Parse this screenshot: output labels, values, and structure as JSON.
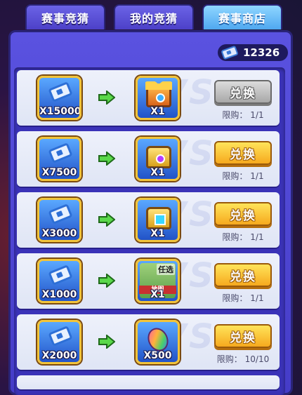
{
  "tabs": [
    {
      "label": "赛事竞猜",
      "active": false
    },
    {
      "label": "我的竞猜",
      "active": false
    },
    {
      "label": "赛事商店",
      "active": true
    }
  ],
  "balance": {
    "icon": "ticket-icon",
    "value": "12326"
  },
  "watermark": "VS",
  "items": [
    {
      "cost": "X15000",
      "reward_icon": "red-crown-chest-icon",
      "reward_qty": "X1",
      "button_label": "兑换",
      "button_state": "disabled",
      "limit_label": "限购：",
      "limit_value": "1/1"
    },
    {
      "cost": "X7500",
      "reward_icon": "gold-chest-icon",
      "reward_qty": "X1",
      "button_label": "兑换",
      "button_state": "enabled",
      "limit_label": "限购：",
      "limit_value": "1/1"
    },
    {
      "cost": "X3000",
      "reward_icon": "blue-gem-chest-icon",
      "reward_qty": "X1",
      "button_label": "兑换",
      "button_state": "enabled",
      "limit_label": "限购：",
      "limit_value": "1/1"
    },
    {
      "cost": "X1000",
      "reward_icon": "optional-card-icon",
      "reward_qty": "X1",
      "reward_tag": "任选",
      "reward_band": "地图",
      "button_label": "兑换",
      "button_state": "enabled",
      "limit_label": "限购：",
      "limit_value": "1/1"
    },
    {
      "cost": "X2000",
      "reward_icon": "rainbow-bean-icon",
      "reward_qty": "X500",
      "button_label": "兑换",
      "button_state": "enabled",
      "limit_label": "限购：",
      "limit_value": "10/10"
    }
  ]
}
